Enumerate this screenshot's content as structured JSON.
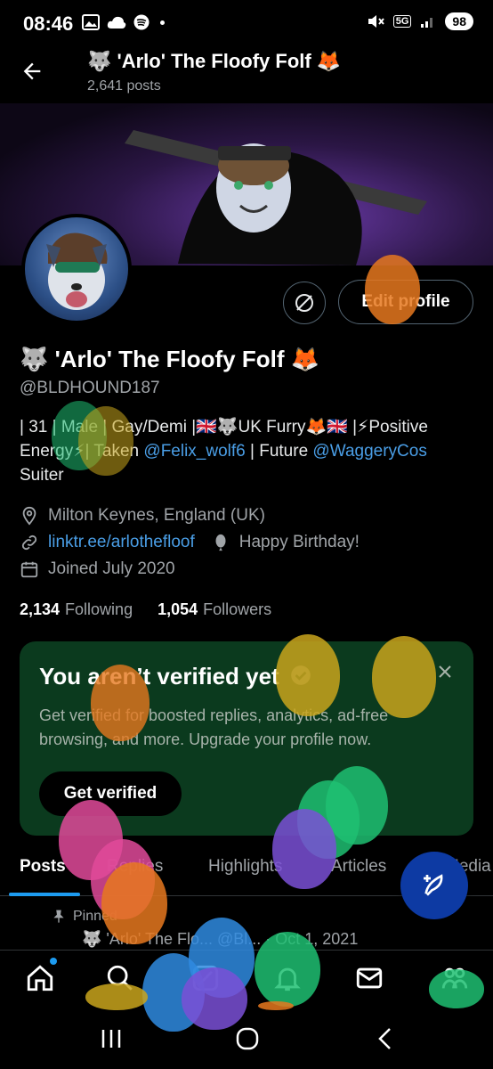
{
  "status_bar": {
    "time": "08:46",
    "network": "5G",
    "battery": "98"
  },
  "header": {
    "title": "🐺 'Arlo' The Floofy Folf 🦊",
    "subtitle": "2,641 posts"
  },
  "profile": {
    "name": "🐺 'Arlo' The Floofy Folf 🦊",
    "handle": "@BLDHOUND187",
    "edit_label": "Edit profile",
    "bio_part1": "| 31 | Male | Gay/Demi |🇬🇧🐺UK Furry🦊🇬🇧 |⚡Positive Energy⚡| Taken ",
    "bio_link1": "@Felix_wolf6",
    "bio_part2": " | Future ",
    "bio_link2": "@WaggeryCos",
    "bio_part3": " Suiter",
    "location": "Milton Keynes, England (UK)",
    "website": "linktr.ee/arlothefloof",
    "birthday": "Happy Birthday!",
    "joined": "Joined July 2020",
    "following_count": "2,134",
    "following_label": "Following",
    "followers_count": "1,054",
    "followers_label": "Followers"
  },
  "verify_card": {
    "title": "You aren’t verified yet",
    "text": "Get verified for boosted replies, analytics, ad-free browsing, and more. Upgrade your profile now.",
    "button": "Get verified"
  },
  "tabs": [
    "Posts",
    "Replies",
    "Highlights",
    "Articles",
    "Media"
  ],
  "pinned_label": "Pinned",
  "pinned_peek": "🐺 'Arlo' The Flo...  @Bl...  · Oct 1, 2021",
  "colors": {
    "accent": "#1d9bf0",
    "card_bg": "#0b3a1e",
    "link": "#4a9ee6"
  },
  "icons": {
    "nav": [
      "home-icon",
      "search-icon",
      "grok-icon",
      "notifications-icon",
      "messages-icon",
      "communities-icon"
    ],
    "fab": "compose-icon"
  }
}
